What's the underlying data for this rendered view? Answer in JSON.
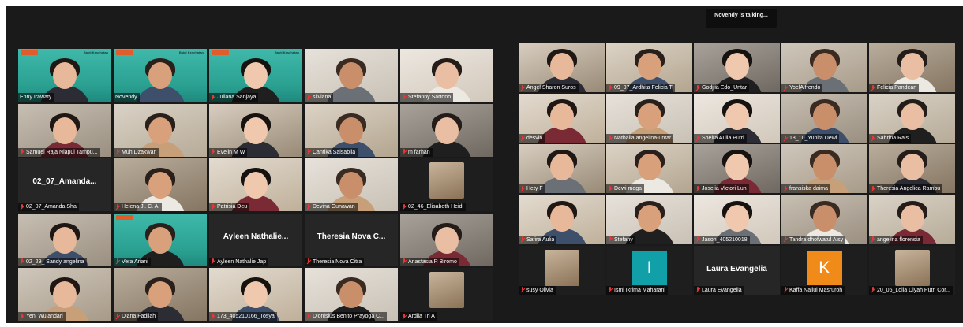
{
  "talking_banner": "Novendy is talking...",
  "colors": {
    "active_speaker_border": "#c8e02c",
    "muted_mic": "#e23a3a",
    "background": "#1a1a1a"
  },
  "left_gallery": [
    {
      "name": "Enny Irawaty",
      "style": "brand",
      "brand_text": "Bakti Kesehatan",
      "muted": false
    },
    {
      "name": "Novendy",
      "style": "brand",
      "brand_text": "Bakti Kesehatan",
      "muted": false,
      "active": true
    },
    {
      "name": "Juliana Sanjaya",
      "style": "brand",
      "brand_text": "Bakti Kesehatan",
      "muted": true
    },
    {
      "name": "silviana",
      "style": "video",
      "muted": true
    },
    {
      "name": "Stefanny Sartono",
      "style": "video",
      "muted": true
    },
    {
      "name": "Samuel Raja Niapul Tampu...",
      "style": "video",
      "muted": true
    },
    {
      "name": "Muh Dzakwan",
      "style": "video",
      "muted": true
    },
    {
      "name": "Evelin M W",
      "style": "video",
      "muted": true
    },
    {
      "name": "Cantika Salsabila",
      "style": "video",
      "muted": true
    },
    {
      "name": "m farhan",
      "style": "video",
      "muted": true
    },
    {
      "name": "02_07_Amanda Sha",
      "style": "card",
      "card_title": "02_07_Amanda...",
      "muted": true
    },
    {
      "name": "Helena Ji. C. A.",
      "style": "video",
      "muted": true
    },
    {
      "name": "Patrisia Deu",
      "style": "video",
      "muted": true
    },
    {
      "name": "Devina Gunawan",
      "style": "video",
      "muted": true
    },
    {
      "name": "02_46_Elisabeth Heidi",
      "style": "photo",
      "muted": true
    },
    {
      "name": "02_29_ Sandy angelina",
      "style": "video",
      "muted": true
    },
    {
      "name": "Vera Ariani",
      "style": "brand",
      "brand_text": "",
      "muted": true
    },
    {
      "name": "Ayleen Nathalie Jap",
      "style": "card",
      "card_title": "Ayleen Nathalie...",
      "muted": true
    },
    {
      "name": "Theresia Nova Citra",
      "style": "card",
      "card_title": "Theresia Nova C...",
      "muted": true
    },
    {
      "name": "Anastasia R Biromo",
      "style": "video",
      "muted": true
    },
    {
      "name": "Yeni Wulandari",
      "style": "video",
      "muted": true
    },
    {
      "name": "Diana Fadilah",
      "style": "video",
      "muted": true
    },
    {
      "name": "173_405210166_Tosya",
      "style": "video",
      "muted": true
    },
    {
      "name": "Dionisius Benito Prayoga C...",
      "style": "video",
      "muted": true
    },
    {
      "name": "Ardila Tri A",
      "style": "photo",
      "muted": true
    }
  ],
  "right_gallery": [
    {
      "name": "Angel Sharon Suros",
      "style": "video",
      "muted": true
    },
    {
      "name": "09_07_Ardhita Felicia T",
      "style": "video",
      "muted": true
    },
    {
      "name": "Godjiia Edo_Untar",
      "style": "video",
      "muted": true
    },
    {
      "name": "YoelAlfrendo",
      "style": "video",
      "muted": true
    },
    {
      "name": "Felicia Pandean",
      "style": "video",
      "muted": true
    },
    {
      "name": "desvin",
      "style": "video",
      "muted": true
    },
    {
      "name": "Nathalia angelina-untar",
      "style": "video",
      "muted": true
    },
    {
      "name": "Sheira Aulia Putri",
      "style": "video",
      "muted": true
    },
    {
      "name": "18_10_Yunita Dewi",
      "style": "video",
      "muted": true
    },
    {
      "name": "Sabrina Rais",
      "style": "video",
      "muted": true
    },
    {
      "name": "Hety F",
      "style": "video",
      "muted": true
    },
    {
      "name": "Dewi mega",
      "style": "video",
      "muted": true
    },
    {
      "name": "Joselia Victori Lun",
      "style": "video",
      "muted": true
    },
    {
      "name": "fransiska daima",
      "style": "video",
      "muted": true
    },
    {
      "name": "Theresia Angelica Rambu",
      "style": "video",
      "muted": true
    },
    {
      "name": "Safira Aulia",
      "style": "video",
      "muted": true
    },
    {
      "name": "Stefany",
      "style": "video",
      "muted": true
    },
    {
      "name": "Jason_405210018",
      "style": "video",
      "muted": true
    },
    {
      "name": "Tandra dhofwatul Aisy",
      "style": "video",
      "muted": true
    },
    {
      "name": "angelina florensia",
      "style": "video",
      "muted": true
    },
    {
      "name": "susy Olivia",
      "style": "photo",
      "muted": true
    },
    {
      "name": "Ismi Ikrima Maharani",
      "style": "avatar",
      "avatar_letter": "I",
      "avatar_color": "#12a0a8",
      "muted": true
    },
    {
      "name": "Laura Evangelia",
      "style": "card",
      "card_title": "Laura Evangelia",
      "muted": true
    },
    {
      "name": "Kaffa Nailul Masruroh",
      "style": "avatar",
      "avatar_letter": "K",
      "avatar_color": "#f08a18",
      "muted": true
    },
    {
      "name": "20_06_Lolia Diyah Putri Cor...",
      "style": "photo",
      "muted": true
    }
  ]
}
